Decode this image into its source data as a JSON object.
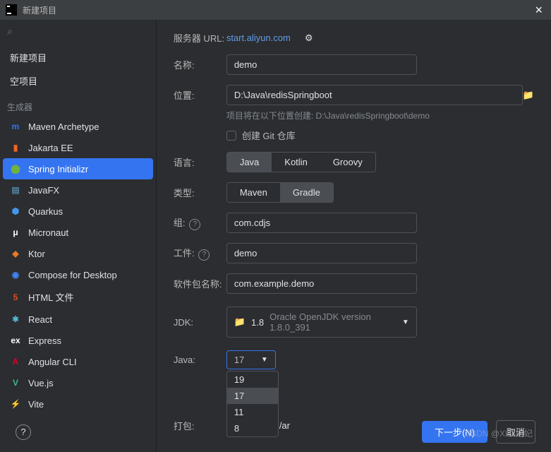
{
  "window": {
    "title": "新建项目"
  },
  "sidebar": {
    "nav": [
      {
        "label": "新建项目"
      },
      {
        "label": "空项目"
      }
    ],
    "section_header": "生成器",
    "generators": [
      {
        "label": "Maven Archetype",
        "icon": "m",
        "color": "#3574f0"
      },
      {
        "label": "Jakarta EE",
        "icon": "▮",
        "color": "#f26522"
      },
      {
        "label": "Spring Initializr",
        "icon": "⬤",
        "color": "#6db33f",
        "selected": true
      },
      {
        "label": "JavaFX",
        "icon": "▤",
        "color": "#5382a1"
      },
      {
        "label": "Quarkus",
        "icon": "⬢",
        "color": "#4695eb"
      },
      {
        "label": "Micronaut",
        "icon": "μ",
        "color": "#ffffff"
      },
      {
        "label": "Ktor",
        "icon": "◆",
        "color": "#e97826"
      },
      {
        "label": "Compose for Desktop",
        "icon": "◉",
        "color": "#4285f4"
      },
      {
        "label": "HTML 文件",
        "icon": "5",
        "color": "#e44d26"
      },
      {
        "label": "React",
        "icon": "⚛",
        "color": "#61dafb"
      },
      {
        "label": "Express",
        "icon": "ex",
        "color": "#ffffff"
      },
      {
        "label": "Angular CLI",
        "icon": "A",
        "color": "#dd0031"
      },
      {
        "label": "Vue.js",
        "icon": "V",
        "color": "#41b883"
      },
      {
        "label": "Vite",
        "icon": "⚡",
        "color": "#ffc21a"
      }
    ]
  },
  "form": {
    "server_label": "服务器 URL:",
    "server_url": "start.aliyun.com",
    "name_label": "名称:",
    "name_value": "demo",
    "location_label": "位置:",
    "location_value": "D:\\Java\\redisSpringboot",
    "location_hint": "项目将在以下位置创建: D:\\Java\\redisSpringboot\\demo",
    "git_label": "创建 Git 仓库",
    "language_label": "语言:",
    "languages": [
      {
        "label": "Java",
        "active": true
      },
      {
        "label": "Kotlin"
      },
      {
        "label": "Groovy"
      }
    ],
    "type_label": "类型:",
    "types": [
      {
        "label": "Maven"
      },
      {
        "label": "Gradle",
        "active": true
      }
    ],
    "group_label": "组:",
    "group_value": "com.cdjs",
    "artifact_label": "工件:",
    "artifact_value": "demo",
    "package_label": "软件包名称:",
    "package_value": "com.example.demo",
    "jdk_label": "JDK:",
    "jdk_value": "1.8",
    "jdk_version": "Oracle OpenJDK version 1.8.0_391",
    "java_label": "Java:",
    "java_value": "17",
    "java_options": [
      {
        "label": "19"
      },
      {
        "label": "17",
        "highlighted": true
      },
      {
        "label": "11"
      },
      {
        "label": "8"
      }
    ],
    "packaging_label": "打包:",
    "packaging_suffix": "/ar"
  },
  "footer": {
    "next": "下一步(N)",
    "cancel": "取消"
  },
  "watermark": "CSDN @XL's妃妃"
}
